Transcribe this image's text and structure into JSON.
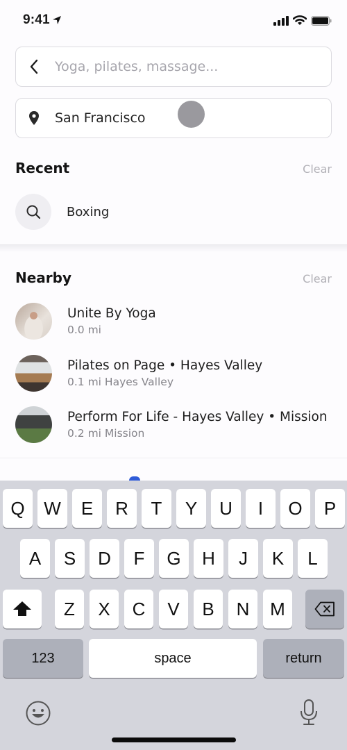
{
  "status_bar": {
    "time": "9:41",
    "icons": [
      "location-arrow-icon",
      "cellular-signal-icon",
      "wifi-icon",
      "battery-icon"
    ]
  },
  "search": {
    "placeholder": "Yoga, pilates, massage...",
    "value": "",
    "back_icon": "chevron-left-icon"
  },
  "location": {
    "value": "San Francisco",
    "icon": "map-pin-icon"
  },
  "recent": {
    "title": "Recent",
    "clear_label": "Clear",
    "items": [
      {
        "label": "Boxing",
        "icon": "search-icon"
      }
    ]
  },
  "nearby": {
    "title": "Nearby",
    "clear_label": "Clear",
    "items": [
      {
        "name": "Unite By Yoga",
        "subtitle": "0.0 mi"
      },
      {
        "name": "Pilates on Page • Hayes Valley",
        "subtitle": "0.1 mi Hayes Valley"
      },
      {
        "name": "Perform For Life - Hayes Valley • Mission",
        "subtitle": "0.2 mi Mission"
      }
    ]
  },
  "keyboard": {
    "row1": [
      "Q",
      "W",
      "E",
      "R",
      "T",
      "Y",
      "U",
      "I",
      "O",
      "P"
    ],
    "row2": [
      "A",
      "S",
      "D",
      "F",
      "G",
      "H",
      "J",
      "K",
      "L"
    ],
    "row3": [
      "Z",
      "X",
      "C",
      "V",
      "B",
      "N",
      "M"
    ],
    "numbers_label": "123",
    "space_label": "space",
    "return_label": "return",
    "icons": [
      "shift-icon",
      "backspace-icon",
      "emoji-icon",
      "microphone-icon"
    ]
  },
  "colors": {
    "accent": "#2f5bd8",
    "keyboard_bg": "#d4d5dc",
    "muted_text": "#86858b"
  }
}
